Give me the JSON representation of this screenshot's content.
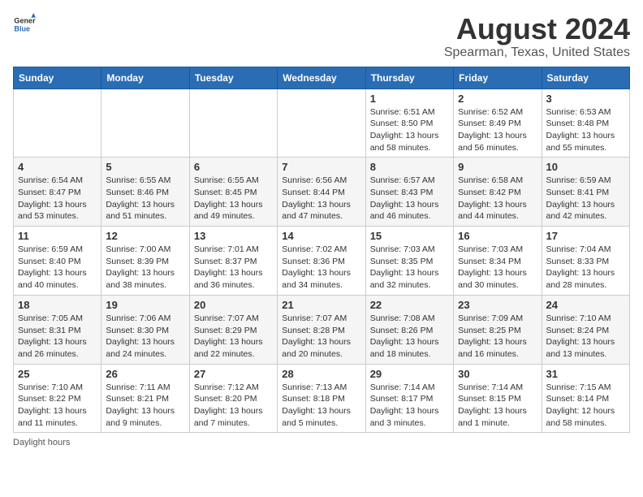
{
  "header": {
    "logo_line1": "General",
    "logo_line2": "Blue",
    "title": "August 2024",
    "subtitle": "Spearman, Texas, United States"
  },
  "days_of_week": [
    "Sunday",
    "Monday",
    "Tuesday",
    "Wednesday",
    "Thursday",
    "Friday",
    "Saturday"
  ],
  "weeks": [
    [
      {
        "day": "",
        "info": ""
      },
      {
        "day": "",
        "info": ""
      },
      {
        "day": "",
        "info": ""
      },
      {
        "day": "",
        "info": ""
      },
      {
        "day": "1",
        "info": "Sunrise: 6:51 AM\nSunset: 8:50 PM\nDaylight: 13 hours\nand 58 minutes."
      },
      {
        "day": "2",
        "info": "Sunrise: 6:52 AM\nSunset: 8:49 PM\nDaylight: 13 hours\nand 56 minutes."
      },
      {
        "day": "3",
        "info": "Sunrise: 6:53 AM\nSunset: 8:48 PM\nDaylight: 13 hours\nand 55 minutes."
      }
    ],
    [
      {
        "day": "4",
        "info": "Sunrise: 6:54 AM\nSunset: 8:47 PM\nDaylight: 13 hours\nand 53 minutes."
      },
      {
        "day": "5",
        "info": "Sunrise: 6:55 AM\nSunset: 8:46 PM\nDaylight: 13 hours\nand 51 minutes."
      },
      {
        "day": "6",
        "info": "Sunrise: 6:55 AM\nSunset: 8:45 PM\nDaylight: 13 hours\nand 49 minutes."
      },
      {
        "day": "7",
        "info": "Sunrise: 6:56 AM\nSunset: 8:44 PM\nDaylight: 13 hours\nand 47 minutes."
      },
      {
        "day": "8",
        "info": "Sunrise: 6:57 AM\nSunset: 8:43 PM\nDaylight: 13 hours\nand 46 minutes."
      },
      {
        "day": "9",
        "info": "Sunrise: 6:58 AM\nSunset: 8:42 PM\nDaylight: 13 hours\nand 44 minutes."
      },
      {
        "day": "10",
        "info": "Sunrise: 6:59 AM\nSunset: 8:41 PM\nDaylight: 13 hours\nand 42 minutes."
      }
    ],
    [
      {
        "day": "11",
        "info": "Sunrise: 6:59 AM\nSunset: 8:40 PM\nDaylight: 13 hours\nand 40 minutes."
      },
      {
        "day": "12",
        "info": "Sunrise: 7:00 AM\nSunset: 8:39 PM\nDaylight: 13 hours\nand 38 minutes."
      },
      {
        "day": "13",
        "info": "Sunrise: 7:01 AM\nSunset: 8:37 PM\nDaylight: 13 hours\nand 36 minutes."
      },
      {
        "day": "14",
        "info": "Sunrise: 7:02 AM\nSunset: 8:36 PM\nDaylight: 13 hours\nand 34 minutes."
      },
      {
        "day": "15",
        "info": "Sunrise: 7:03 AM\nSunset: 8:35 PM\nDaylight: 13 hours\nand 32 minutes."
      },
      {
        "day": "16",
        "info": "Sunrise: 7:03 AM\nSunset: 8:34 PM\nDaylight: 13 hours\nand 30 minutes."
      },
      {
        "day": "17",
        "info": "Sunrise: 7:04 AM\nSunset: 8:33 PM\nDaylight: 13 hours\nand 28 minutes."
      }
    ],
    [
      {
        "day": "18",
        "info": "Sunrise: 7:05 AM\nSunset: 8:31 PM\nDaylight: 13 hours\nand 26 minutes."
      },
      {
        "day": "19",
        "info": "Sunrise: 7:06 AM\nSunset: 8:30 PM\nDaylight: 13 hours\nand 24 minutes."
      },
      {
        "day": "20",
        "info": "Sunrise: 7:07 AM\nSunset: 8:29 PM\nDaylight: 13 hours\nand 22 minutes."
      },
      {
        "day": "21",
        "info": "Sunrise: 7:07 AM\nSunset: 8:28 PM\nDaylight: 13 hours\nand 20 minutes."
      },
      {
        "day": "22",
        "info": "Sunrise: 7:08 AM\nSunset: 8:26 PM\nDaylight: 13 hours\nand 18 minutes."
      },
      {
        "day": "23",
        "info": "Sunrise: 7:09 AM\nSunset: 8:25 PM\nDaylight: 13 hours\nand 16 minutes."
      },
      {
        "day": "24",
        "info": "Sunrise: 7:10 AM\nSunset: 8:24 PM\nDaylight: 13 hours\nand 13 minutes."
      }
    ],
    [
      {
        "day": "25",
        "info": "Sunrise: 7:10 AM\nSunset: 8:22 PM\nDaylight: 13 hours\nand 11 minutes."
      },
      {
        "day": "26",
        "info": "Sunrise: 7:11 AM\nSunset: 8:21 PM\nDaylight: 13 hours\nand 9 minutes."
      },
      {
        "day": "27",
        "info": "Sunrise: 7:12 AM\nSunset: 8:20 PM\nDaylight: 13 hours\nand 7 minutes."
      },
      {
        "day": "28",
        "info": "Sunrise: 7:13 AM\nSunset: 8:18 PM\nDaylight: 13 hours\nand 5 minutes."
      },
      {
        "day": "29",
        "info": "Sunrise: 7:14 AM\nSunset: 8:17 PM\nDaylight: 13 hours\nand 3 minutes."
      },
      {
        "day": "30",
        "info": "Sunrise: 7:14 AM\nSunset: 8:15 PM\nDaylight: 13 hours\nand 1 minute."
      },
      {
        "day": "31",
        "info": "Sunrise: 7:15 AM\nSunset: 8:14 PM\nDaylight: 12 hours\nand 58 minutes."
      }
    ]
  ],
  "footer": "Daylight hours"
}
